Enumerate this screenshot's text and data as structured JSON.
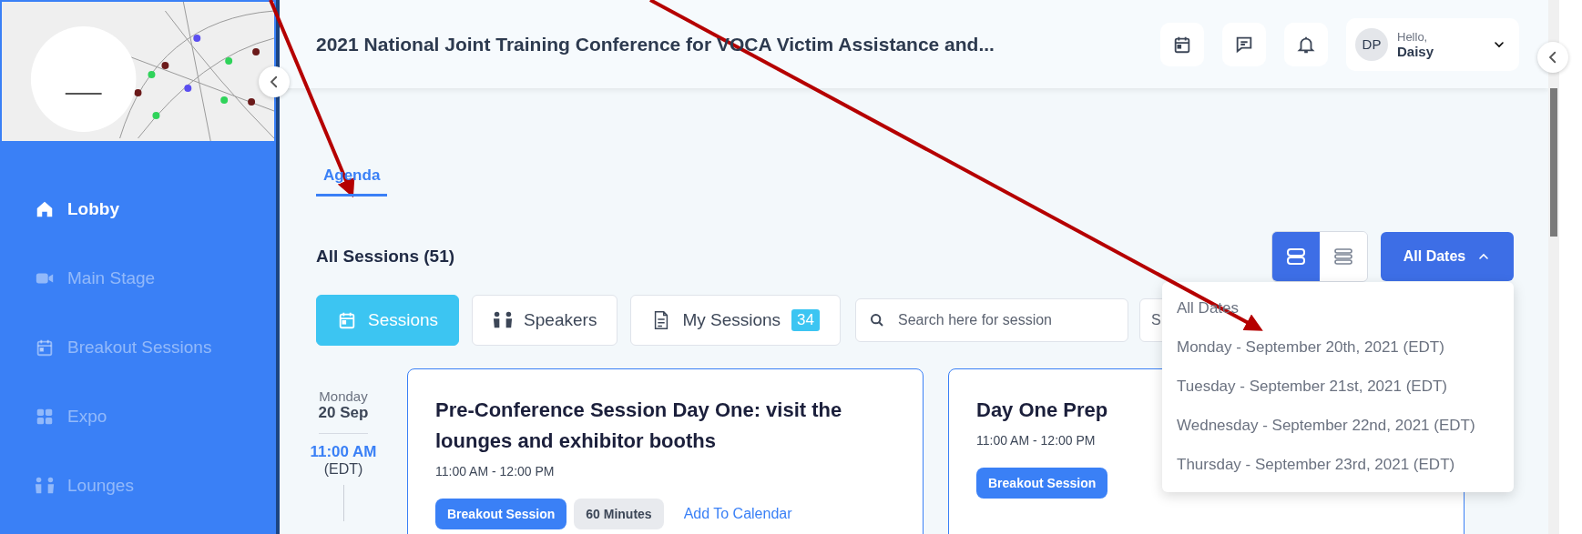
{
  "sidebar": {
    "items": [
      {
        "label": "Lobby",
        "kind": "home",
        "selected": true
      },
      {
        "label": "Main Stage",
        "kind": "video",
        "selected": false
      },
      {
        "label": "Breakout Sessions",
        "kind": "calendar",
        "selected": false
      },
      {
        "label": "Expo",
        "kind": "grid",
        "selected": false
      },
      {
        "label": "Lounges",
        "kind": "people",
        "selected": false
      }
    ]
  },
  "header": {
    "title": "2021 National Joint Training Conference for VOCA Victim Assistance and...",
    "user": {
      "initials": "DP",
      "greeting": "Hello,",
      "name": "Daisy"
    }
  },
  "tabs": [
    {
      "label": "Agenda",
      "selected": true
    }
  ],
  "sessions_heading": "All Sessions (51)",
  "view_toggle": [
    {
      "kind": "cards",
      "selected": true
    },
    {
      "kind": "list",
      "selected": false
    }
  ],
  "date_filter": {
    "label": "All Dates",
    "expanded": true,
    "options": [
      {
        "label": "All Dates"
      },
      {
        "label": "Monday - September 20th, 2021 (EDT)"
      },
      {
        "label": "Tuesday - September 21st, 2021 (EDT)"
      },
      {
        "label": "Wednesday - September 22nd, 2021 (EDT)"
      },
      {
        "label": "Thursday - September 23rd, 2021 (EDT)"
      }
    ]
  },
  "filters": [
    {
      "label": "Sessions",
      "kind": "calendar",
      "selected": true
    },
    {
      "label": "Speakers",
      "kind": "people",
      "selected": false
    },
    {
      "label": "My Sessions",
      "kind": "document",
      "selected": false,
      "count": "34"
    }
  ],
  "search": {
    "placeholder": "Search here for session"
  },
  "second_field": {
    "value": "S"
  },
  "day": {
    "weekday": "Monday",
    "date": "20 Sep",
    "time": "11:00 AM",
    "zone": "(EDT)"
  },
  "cards": [
    {
      "title": "Pre-Conference Session Day One: visit the lounges and exhibitor booths",
      "time": "11:00 AM - 12:00 PM",
      "tags": [
        {
          "label": "Breakout Session",
          "kind": "type"
        },
        {
          "label": "60 Minutes",
          "kind": "duration"
        }
      ],
      "link": "Add To Calendar"
    },
    {
      "title": "Day One Prep",
      "time": "11:00 AM - 12:00 PM",
      "tags": [
        {
          "label": "Breakout Session",
          "kind": "type"
        }
      ]
    }
  ]
}
